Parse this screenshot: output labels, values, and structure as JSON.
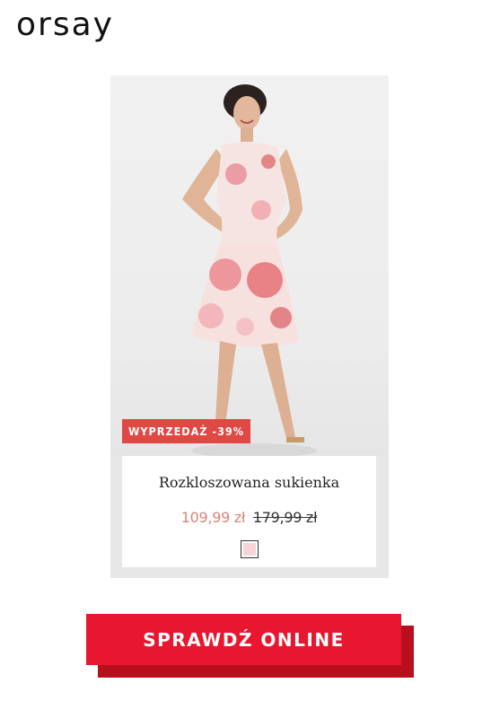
{
  "brand": {
    "logo_text": "orsay"
  },
  "product": {
    "badge": "WYPRZEDAŻ -39%",
    "name": "Rozkloszowana sukienka",
    "price_new": "109,99 zł",
    "price_old": "179,99 zł",
    "swatch_color": "#f5d3d6",
    "image_alt": "model in floral sleeveless dress"
  },
  "cta": {
    "label": "SPRAWDŹ ONLINE"
  },
  "colors": {
    "badge": "#e04844",
    "price_new": "#d9827a",
    "cta": "#e8172f",
    "cta_shadow": "#b80f1d",
    "card_frame": "#e7e7e7"
  }
}
